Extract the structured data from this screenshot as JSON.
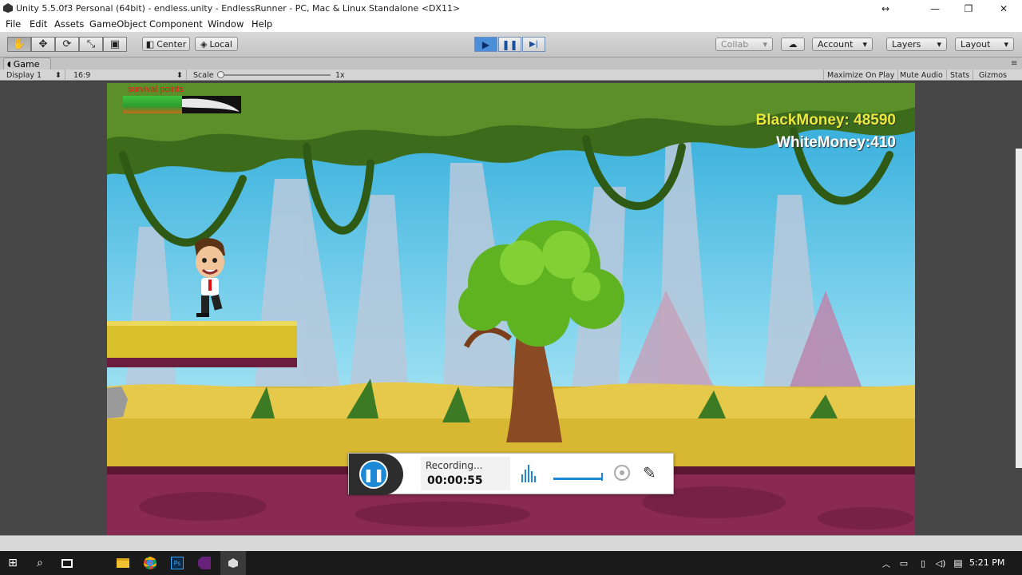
{
  "window": {
    "title": "Unity 5.5.0f3 Personal (64bit) - endless.unity - EndlessRunner - PC, Mac & Linux Standalone <DX11>",
    "controls": {
      "resize": "↔",
      "minimize": "—",
      "restore": "❐",
      "close": "✕"
    }
  },
  "menu": [
    "File",
    "Edit",
    "Assets",
    "GameObject",
    "Component",
    "Window",
    "Help"
  ],
  "toolbar": {
    "tools": [
      "hand-tool",
      "move-tool",
      "rotate-tool",
      "scale-tool",
      "rect-tool"
    ],
    "tool_glyphs": [
      "✋",
      "✥",
      "⟳",
      "⤡",
      "▣"
    ],
    "pivot_label": "Center",
    "space_label": "Local",
    "play_glyph": "▶",
    "pause_glyph": "❚❚",
    "step_glyph": "▶|",
    "collab_label": "Collab",
    "cloud_glyph": "☁",
    "account_label": "Account",
    "layers_label": "Layers",
    "layout_label": "Layout"
  },
  "game_tab": {
    "label": "Game",
    "display": "Display 1",
    "aspect": "16:9",
    "scale_label": "Scale",
    "scale_value": "1x",
    "scale_slider_value": 0.0,
    "maximize_label": "Maximize On Play",
    "mute_label": "Mute Audio",
    "stats_label": "Stats",
    "gizmos_label": "Gizmos"
  },
  "game": {
    "survival_label": "survival points",
    "survival_fill": 0.5,
    "black_money": "BlackMoney: 48590",
    "white_money": "WhiteMoney:410"
  },
  "recorder": {
    "status": "Recording...",
    "time": "00:00:55",
    "pause_glyph": "❚❚",
    "pen_glyph": "✎"
  },
  "taskbar": {
    "clock": "5:21 PM",
    "start_glyph": "⊞",
    "search_glyph": "⌕",
    "apps": [
      "file-explorer",
      "chrome",
      "photoshop",
      "visual-studio",
      "unity"
    ]
  },
  "colors": {
    "play_active": "#4a8fd8",
    "black_money": "#e8ea3a",
    "survival_bar_fill": "#3fc43f",
    "recorder_button": "#1d89d6"
  }
}
